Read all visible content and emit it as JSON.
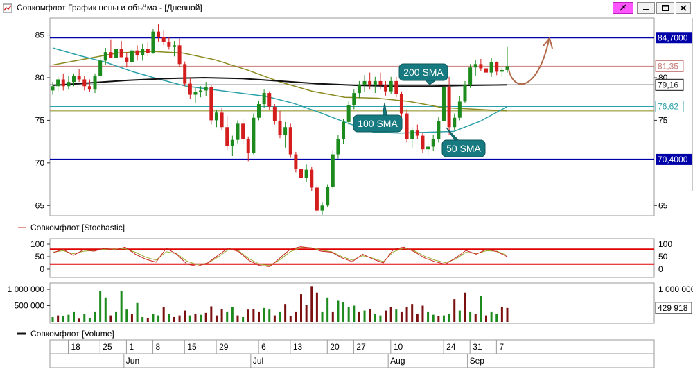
{
  "window": {
    "title": "Совкомфлот График цены и объёма - [Дневной]"
  },
  "colors": {
    "up": "#1c8a1c",
    "down": "#d41e1e",
    "sma50": "#2aa0a8",
    "sma100": "#8a8a1e",
    "sma200": "#111111",
    "level": "#0000a8",
    "stoch_k": "#cc2222",
    "stoch_d": "#9aa82a",
    "stoch_band": "#e00000",
    "vol_up": "#1c8a1c",
    "vol_down": "#7a1010",
    "callout": "#177a80",
    "arrow": "#b06a4a"
  },
  "price_panel": {
    "ticks": [
      "85",
      "80",
      "75",
      "70",
      "65"
    ],
    "right_ticks": [
      "80",
      "75",
      "65"
    ],
    "levels": [
      {
        "value": 84.7,
        "label": "84,7000"
      },
      {
        "value": 70.4,
        "label": "70,4000"
      }
    ],
    "tags": [
      {
        "value": 81.35,
        "label": "81,35",
        "color": "#c87a7a",
        "line": "#c87a7a"
      },
      {
        "value": 79.16,
        "label": "79,16",
        "color": "#111111",
        "line": "#111111"
      },
      {
        "value": 76.62,
        "label": "76,62",
        "color": "#2aa0a8",
        "line": "#2aa0a8"
      },
      {
        "value": 76.1,
        "label": "",
        "color": "#8a8a1e",
        "line": "#8a8a1e"
      }
    ],
    "callouts": {
      "sma200": "200 SMA",
      "sma100": "100 SMA",
      "sma50": "50 SMA"
    }
  },
  "stoch_panel": {
    "legend": "Совкомфлот [Stochastic]",
    "ticks": [
      "100",
      "50",
      "0"
    ],
    "bands": [
      80,
      20
    ]
  },
  "volume_panel": {
    "ticks": [
      "1 000 000",
      "500 000"
    ],
    "right_ticks": [
      "1 000 000"
    ],
    "last_label": "429 918",
    "legend": "Совкомфлот [Volume]"
  },
  "date_axis": {
    "days": [
      "18",
      "25",
      "1",
      "8",
      "15",
      "29",
      "6",
      "13",
      "20",
      "27",
      "10",
      "24",
      "31",
      "7"
    ],
    "months": [
      "Jun",
      "Jul",
      "Aug",
      "Sep"
    ]
  },
  "chart_data": {
    "type": "candlestick",
    "y_range": [
      63.8,
      87.0
    ],
    "candles": [
      [
        78.5,
        79.5,
        78,
        79
      ],
      [
        79,
        80.2,
        78.3,
        79.8
      ],
      [
        79.8,
        80.5,
        78.5,
        79
      ],
      [
        79,
        80.2,
        78.6,
        79.5
      ],
      [
        79.5,
        80.5,
        79,
        80.2
      ],
      [
        80.2,
        81,
        79.5,
        79.8
      ],
      [
        79.8,
        80.2,
        78.5,
        79
      ],
      [
        79,
        79.8,
        78.3,
        78.6
      ],
      [
        78.6,
        80.5,
        78.2,
        80.2
      ],
      [
        80.2,
        82.5,
        80,
        82
      ],
      [
        82,
        83.5,
        81.5,
        83
      ],
      [
        83,
        84.5,
        82.5,
        82.3
      ],
      [
        82.3,
        83.8,
        81.8,
        83.4
      ],
      [
        83.4,
        84.3,
        82.5,
        82.4
      ],
      [
        82.4,
        83,
        81.2,
        81.8
      ],
      [
        81.8,
        83.5,
        81.5,
        83.2
      ],
      [
        83.2,
        83.8,
        82,
        82.6
      ],
      [
        82.6,
        84,
        82,
        83.4
      ],
      [
        83.4,
        84.2,
        82.5,
        82.9
      ],
      [
        82.9,
        85.7,
        82.8,
        85.4
      ],
      [
        85.4,
        86.3,
        84.2,
        84.8
      ],
      [
        84.8,
        85.6,
        83.8,
        84.2
      ],
      [
        84.2,
        84.8,
        83.3,
        83.6
      ],
      [
        83.6,
        84.3,
        82.5,
        83.8
      ],
      [
        83.8,
        84.6,
        81.3,
        81.6
      ],
      [
        81.6,
        81.9,
        79,
        79.3
      ],
      [
        79.3,
        80,
        77.5,
        78
      ],
      [
        78,
        78.8,
        77,
        78.3
      ],
      [
        78.3,
        79,
        77.7,
        78.5
      ],
      [
        78.5,
        79.5,
        77.8,
        78.9
      ],
      [
        78.9,
        79.2,
        74.5,
        75
      ],
      [
        75,
        76.2,
        74.2,
        75.9
      ],
      [
        75.9,
        76.5,
        73.8,
        74.2
      ],
      [
        74.2,
        75.5,
        71.5,
        72
      ],
      [
        72,
        73.2,
        70.8,
        72.7
      ],
      [
        72.7,
        75,
        72.3,
        74.6
      ],
      [
        74.6,
        75.2,
        72.2,
        72.8
      ],
      [
        72.8,
        73.1,
        70.2,
        71.2
      ],
      [
        71.2,
        75.8,
        71,
        75.3
      ],
      [
        75.3,
        77.3,
        75,
        76.9
      ],
      [
        76.9,
        78.6,
        76.5,
        78.2
      ],
      [
        78.2,
        78.4,
        76.2,
        76.6
      ],
      [
        76.6,
        76.9,
        74.5,
        74.9
      ],
      [
        74.9,
        76.1,
        72.9,
        73.3
      ],
      [
        73.3,
        74.8,
        71.8,
        74.2
      ],
      [
        74.2,
        74.6,
        70.6,
        71
      ],
      [
        71,
        71.3,
        68.9,
        69.3
      ],
      [
        69.3,
        69.6,
        67.4,
        68.2
      ],
      [
        68.2,
        69.8,
        67.8,
        69.2
      ],
      [
        69.2,
        69.5,
        66.7,
        67.1
      ],
      [
        67.1,
        67.4,
        64,
        64.4
      ],
      [
        64.4,
        65.4,
        63.9,
        65
      ],
      [
        65,
        67.5,
        64.8,
        67.2
      ],
      [
        67.2,
        71.5,
        67,
        71
      ],
      [
        71,
        73.3,
        70.5,
        72.8
      ],
      [
        72.8,
        75.2,
        72.2,
        74.8
      ],
      [
        74.8,
        77.2,
        74.5,
        76.8
      ],
      [
        76.8,
        78.6,
        76.3,
        78.2
      ],
      [
        78.2,
        79.6,
        77.6,
        79.2
      ],
      [
        79.2,
        80.3,
        78.3,
        79.6
      ],
      [
        79.6,
        80.6,
        78.6,
        79.1
      ],
      [
        79.1,
        80.1,
        78.2,
        79.6
      ],
      [
        79.6,
        80.6,
        78.7,
        79.1
      ],
      [
        79.1,
        79.6,
        77.9,
        78.4
      ],
      [
        78.4,
        80.1,
        78.1,
        79.6
      ],
      [
        79.6,
        80.1,
        77.7,
        78.1
      ],
      [
        78.1,
        78.4,
        75.4,
        75.8
      ],
      [
        75.8,
        76.3,
        72.4,
        72.8
      ],
      [
        72.8,
        74.2,
        71.8,
        73.8
      ],
      [
        73.8,
        74.5,
        72.8,
        73.2
      ],
      [
        73.2,
        73.6,
        71.2,
        71.6
      ],
      [
        71.6,
        72.3,
        70.8,
        71.9
      ],
      [
        71.9,
        73.3,
        71.4,
        72.8
      ],
      [
        72.8,
        75.4,
        72.4,
        74.9
      ],
      [
        74.9,
        79.3,
        74.7,
        78.9
      ],
      [
        78.9,
        80.1,
        73.3,
        74.2
      ],
      [
        74.2,
        75.8,
        73.8,
        75.3
      ],
      [
        75.3,
        77.8,
        75,
        77.2
      ],
      [
        77.2,
        79.6,
        77,
        79.2
      ],
      [
        79.2,
        81.6,
        78.8,
        81.2
      ],
      [
        81.2,
        82.1,
        80.2,
        81.6
      ],
      [
        81.6,
        82.2,
        80.8,
        81.1
      ],
      [
        81.1,
        81.7,
        80.3,
        80.6
      ],
      [
        80.6,
        82.3,
        80.1,
        81.8
      ],
      [
        81.8,
        81.9,
        80.3,
        80.7
      ],
      [
        80.7,
        81.2,
        80.1,
        80.9
      ],
      [
        80.9,
        83.6,
        80.6,
        81.35
      ]
    ],
    "sma50": [
      83.5,
      82.6,
      81.8,
      80.7,
      79.8,
      79,
      78.6,
      78.2,
      77.8,
      77,
      75.9,
      74.7,
      73.6,
      73.5,
      73.6,
      73.7,
      74.9,
      76.62
    ],
    "sma100": [
      81.5,
      82.2,
      82.9,
      83.1,
      82.9,
      82.1,
      80.9,
      79.5,
      78.4,
      77.7,
      77.6,
      77.2,
      76.5,
      76.3,
      76.1
    ],
    "sma200": [
      79.1,
      79.4,
      79.7,
      79.9,
      80,
      79.9,
      79.6,
      79.3,
      79.1,
      79.0,
      79.0,
      79.1,
      79.16
    ],
    "stochastic": {
      "k": [
        65,
        80,
        55,
        78,
        72,
        84,
        76,
        88,
        60,
        40,
        28,
        84,
        60,
        20,
        12,
        25,
        55,
        85,
        70,
        35,
        15,
        10,
        45,
        80,
        90,
        85,
        72,
        68,
        45,
        30,
        60,
        40,
        25,
        80,
        88,
        70,
        45,
        30,
        20,
        45,
        75,
        60,
        80,
        70,
        50
      ],
      "d": [
        68,
        74,
        62,
        72,
        75,
        80,
        80,
        82,
        68,
        48,
        36,
        70,
        62,
        32,
        18,
        24,
        48,
        78,
        74,
        42,
        20,
        14,
        38,
        70,
        86,
        86,
        76,
        70,
        50,
        36,
        54,
        44,
        30,
        70,
        84,
        74,
        52,
        36,
        26,
        40,
        68,
        62,
        74,
        72,
        55
      ]
    },
    "volume": [
      [
        0.15,
        1
      ],
      [
        0.2,
        0
      ],
      [
        0.18,
        1
      ],
      [
        0.22,
        1
      ],
      [
        0.3,
        1
      ],
      [
        0.1,
        0
      ],
      [
        0.25,
        1
      ],
      [
        0.12,
        1
      ],
      [
        0.3,
        1
      ],
      [
        0.95,
        1
      ],
      [
        0.75,
        1
      ],
      [
        0.2,
        0
      ],
      [
        0.3,
        1
      ],
      [
        0.95,
        1
      ],
      [
        0.38,
        1
      ],
      [
        0.25,
        0
      ],
      [
        0.58,
        1
      ],
      [
        0.15,
        1
      ],
      [
        0.12,
        0
      ],
      [
        0.25,
        1
      ],
      [
        0.2,
        1
      ],
      [
        0.45,
        0
      ],
      [
        0.25,
        1
      ],
      [
        0.15,
        0
      ],
      [
        0.2,
        0
      ],
      [
        0.35,
        0
      ],
      [
        0.2,
        1
      ],
      [
        0.25,
        0
      ],
      [
        0.22,
        1
      ],
      [
        0.28,
        0
      ],
      [
        0.48,
        0
      ],
      [
        0.2,
        0
      ],
      [
        0.4,
        0
      ],
      [
        0.3,
        1
      ],
      [
        0.45,
        1
      ],
      [
        0.2,
        0
      ],
      [
        0.15,
        1
      ],
      [
        0.38,
        0
      ],
      [
        0.4,
        0
      ],
      [
        0.3,
        0
      ],
      [
        0.43,
        1
      ],
      [
        0.38,
        1
      ],
      [
        0.2,
        0
      ],
      [
        0.3,
        1
      ],
      [
        0.55,
        0
      ],
      [
        0.18,
        0
      ],
      [
        0.3,
        0
      ],
      [
        0.85,
        0
      ],
      [
        0.52,
        0
      ],
      [
        1.1,
        0
      ],
      [
        0.9,
        0
      ],
      [
        0.3,
        1
      ],
      [
        0.75,
        1
      ],
      [
        0.3,
        0
      ],
      [
        0.65,
        1
      ],
      [
        0.6,
        1
      ],
      [
        0.45,
        1
      ],
      [
        0.5,
        1
      ],
      [
        0.3,
        0
      ],
      [
        0.35,
        1
      ],
      [
        0.4,
        0
      ],
      [
        0.25,
        1
      ],
      [
        0.2,
        1
      ],
      [
        0.35,
        0
      ],
      [
        0.45,
        0
      ],
      [
        0.38,
        1
      ],
      [
        0.3,
        0
      ],
      [
        0.45,
        0
      ],
      [
        0.55,
        0
      ],
      [
        0.25,
        0
      ],
      [
        0.5,
        0
      ],
      [
        0.3,
        1
      ],
      [
        0.22,
        1
      ],
      [
        0.18,
        0
      ],
      [
        0.2,
        1
      ],
      [
        0.25,
        1
      ],
      [
        0.7,
        0
      ],
      [
        0.35,
        1
      ],
      [
        0.9,
        0
      ],
      [
        0.3,
        1
      ],
      [
        0.25,
        0
      ],
      [
        0.8,
        1
      ],
      [
        0.2,
        0
      ],
      [
        0.3,
        1
      ],
      [
        0.25,
        1
      ],
      [
        0.45,
        0
      ],
      [
        0.43,
        0
      ]
    ]
  }
}
